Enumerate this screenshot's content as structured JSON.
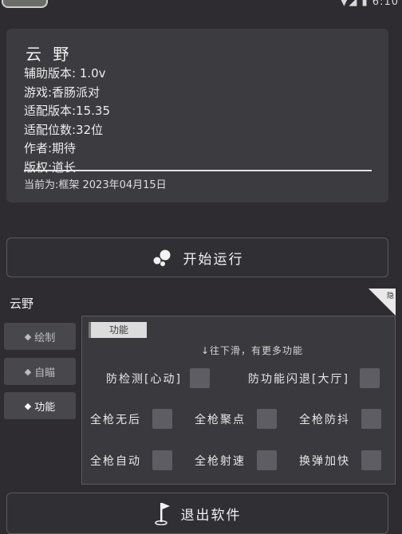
{
  "status_bar": {
    "time": "6:10"
  },
  "info": {
    "title": "云 野",
    "lines": [
      "辅助版本: 1.0v",
      "游戏:香肠派对",
      "适配版本:15.35",
      "适配位数:32位",
      "作者:期待",
      "版权:道长"
    ],
    "current": "当前为:框架  2023年04月15日"
  },
  "start_button": {
    "label": "开始运行"
  },
  "panel": {
    "title": "云野",
    "hide_label": "隐",
    "tabs": [
      {
        "label": "绘制"
      },
      {
        "label": "自瞄"
      },
      {
        "label": "功能"
      }
    ],
    "function_label": "功能",
    "hint": "↓往下滑，有更多功能",
    "options": [
      "防检测[心动]",
      "防功能闪退[大厅]",
      "全枪无后",
      "全枪聚点",
      "全枪防抖",
      "全枪自动",
      "全枪射速",
      "换弹加快"
    ]
  },
  "exit_button": {
    "label": "退出软件"
  }
}
